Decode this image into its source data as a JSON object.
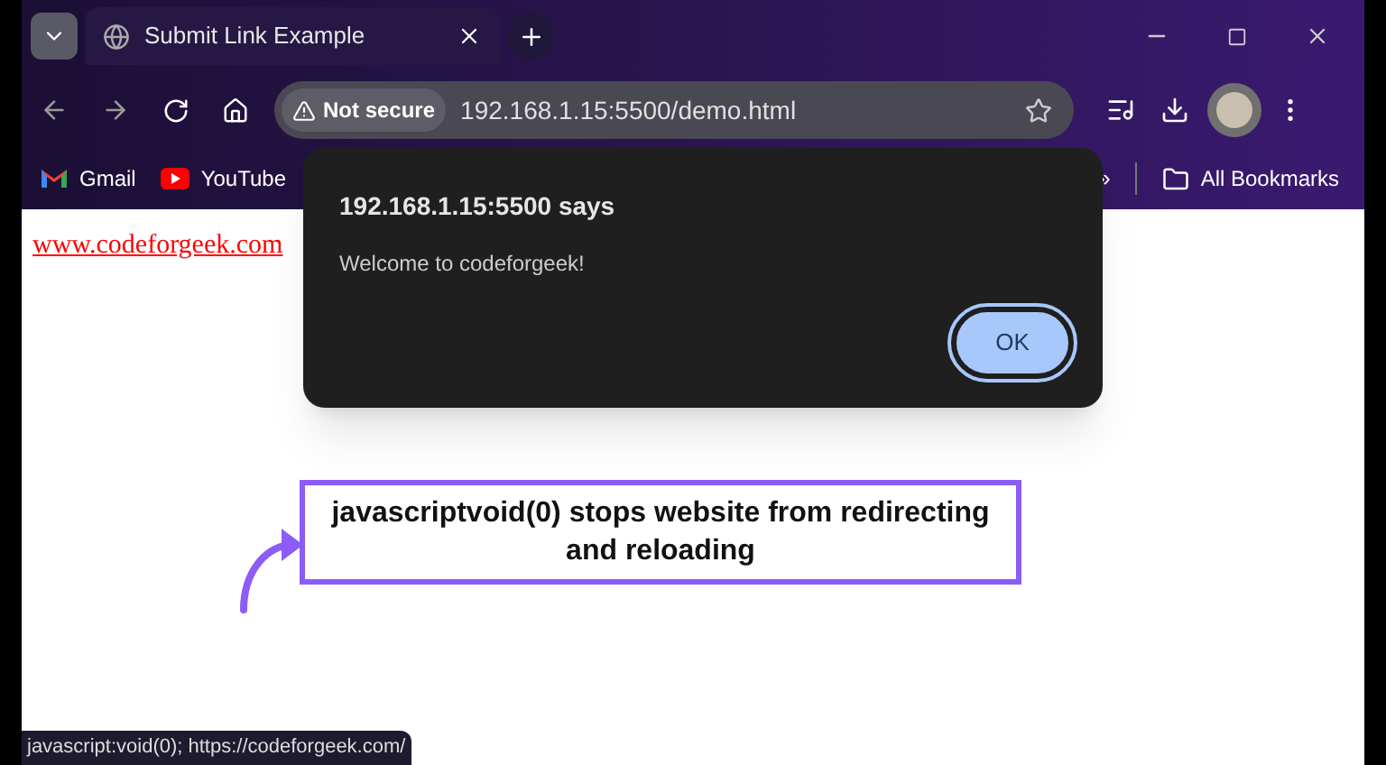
{
  "tab": {
    "title": "Submit Link Example",
    "selected": true
  },
  "toolbar": {
    "security": "Not secure",
    "url": "192.168.1.15:5500/demo.html"
  },
  "bookmarks": [
    {
      "label": "Gmail",
      "kind": "gmail"
    },
    {
      "label": "YouTube",
      "kind": "youtube"
    }
  ],
  "bookmarks_overflow": "»",
  "all_bookmarks": "All Bookmarks",
  "page": {
    "link": "www.codeforgeek.com"
  },
  "dialog": {
    "title": "192.168.1.15:5500 says",
    "message": "Welcome to codeforgeek!",
    "button": "OK"
  },
  "annotation": "javascriptvoid(0) stops website from redirecting and reloading",
  "status_bar": "javascript:void(0); https://codeforgeek.com/"
}
